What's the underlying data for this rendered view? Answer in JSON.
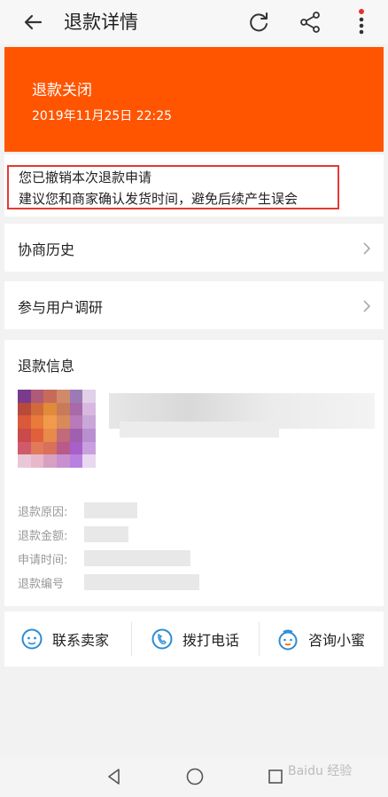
{
  "header": {
    "title": "退款详情"
  },
  "status": {
    "title": "退款关闭",
    "time": "2019年11月25日 22:25"
  },
  "notice": {
    "line1": "您已撤销本次退款申请",
    "line2": "建议您和商家确认发货时间，避免后续产生误会"
  },
  "rows": {
    "history": "协商历史",
    "research": "参与用户调研"
  },
  "info": {
    "header": "退款信息",
    "reason_label": "退款原因:",
    "amount_label": "退款金额:",
    "time_label": "申请时间:",
    "number_label": "退款编号"
  },
  "actions": {
    "contact_seller": "联系卖家",
    "call": "拨打电话",
    "consult": "咨询小蜜"
  },
  "colors": {
    "accent": "#ff5500",
    "highlight_border": "#e53935",
    "icon_blue": "#2c8cd6"
  },
  "watermark": "Baidu 经验"
}
